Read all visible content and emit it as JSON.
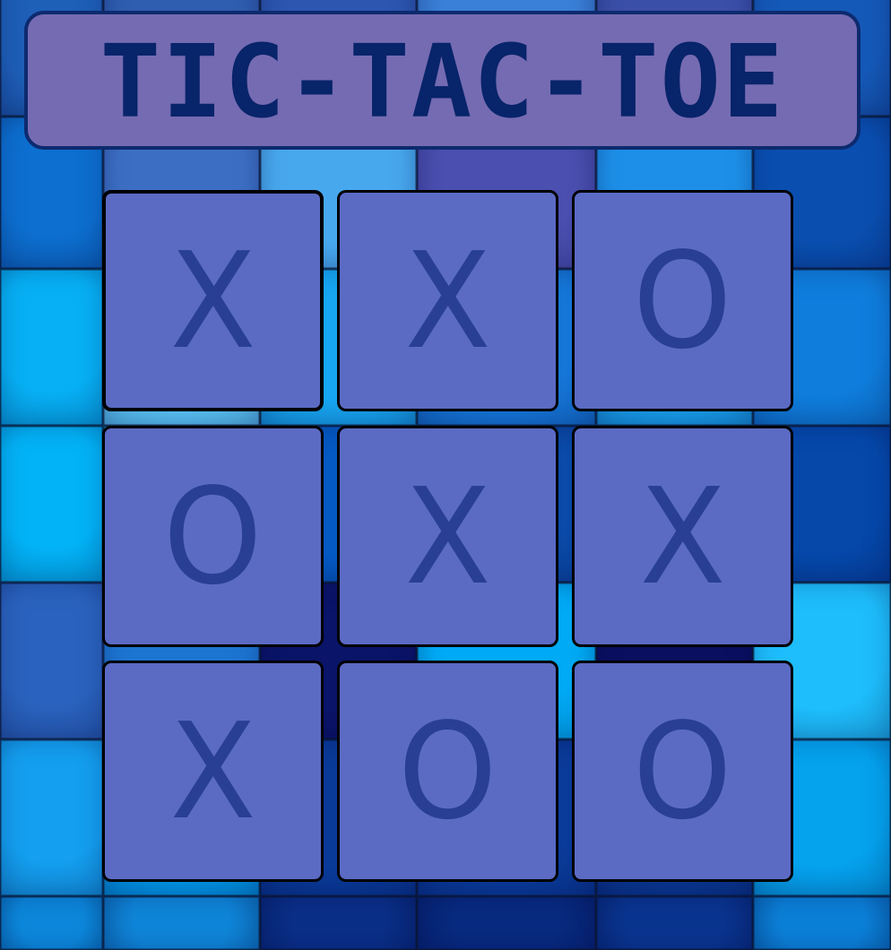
{
  "title": "TIC-TAC-TOE",
  "board": {
    "cells": [
      "X",
      "X",
      "O",
      "O",
      "X",
      "X",
      "X",
      "O",
      "O"
    ],
    "focused_cell": 0
  },
  "colors": {
    "title_bg": "#756bb2",
    "title_text": "#08246a",
    "cell_bg": "#5b6bc4",
    "mark": "#283f94"
  }
}
